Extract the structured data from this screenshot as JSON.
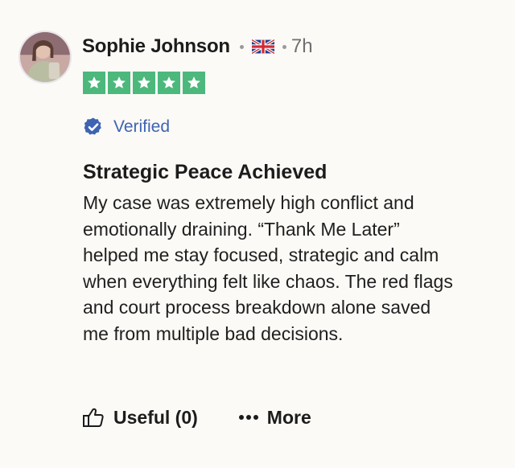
{
  "reviewer": {
    "name": "Sophie Johnson",
    "country_icon": "uk-flag-icon",
    "time_ago": "7h"
  },
  "rating": {
    "stars": 5,
    "max": 5,
    "color": "#4cb87c"
  },
  "verified": {
    "label": "Verified",
    "color": "#3e63b3"
  },
  "review": {
    "title": "Strategic Peace Achieved",
    "body": "My case was extremely high conflict and\nemotionally draining. “Thank Me Later”\nhelped me stay focused, strategic and calm\nwhen everything felt like chaos. The red flags\nand court process breakdown alone saved\nme from multiple bad decisions."
  },
  "actions": {
    "useful_label": "Useful (0)",
    "more_label": "More",
    "useful_icon": "thumbs-up-icon",
    "more_icon": "ellipsis-icon"
  }
}
